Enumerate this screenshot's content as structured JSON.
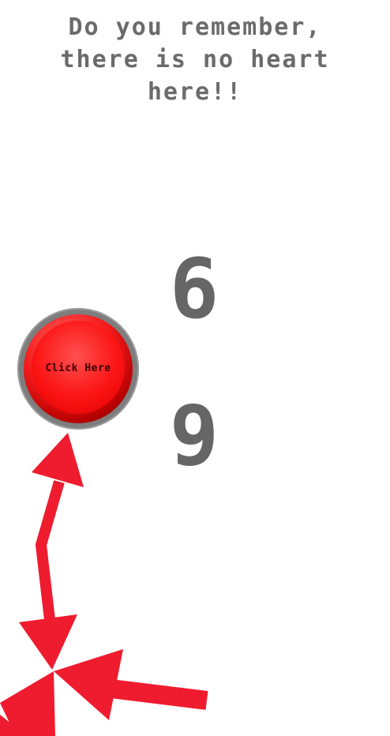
{
  "message": {
    "line1": "Do you remember,",
    "line2": "there is no heart",
    "line3": "here!!"
  },
  "counter": {
    "top_digit": "6",
    "bottom_digit": "9"
  },
  "button": {
    "label": "Click Here"
  },
  "colors": {
    "text": "#6b6b6b",
    "button_red": "#f31a1a",
    "arrow_red": "#ee1c2e"
  }
}
